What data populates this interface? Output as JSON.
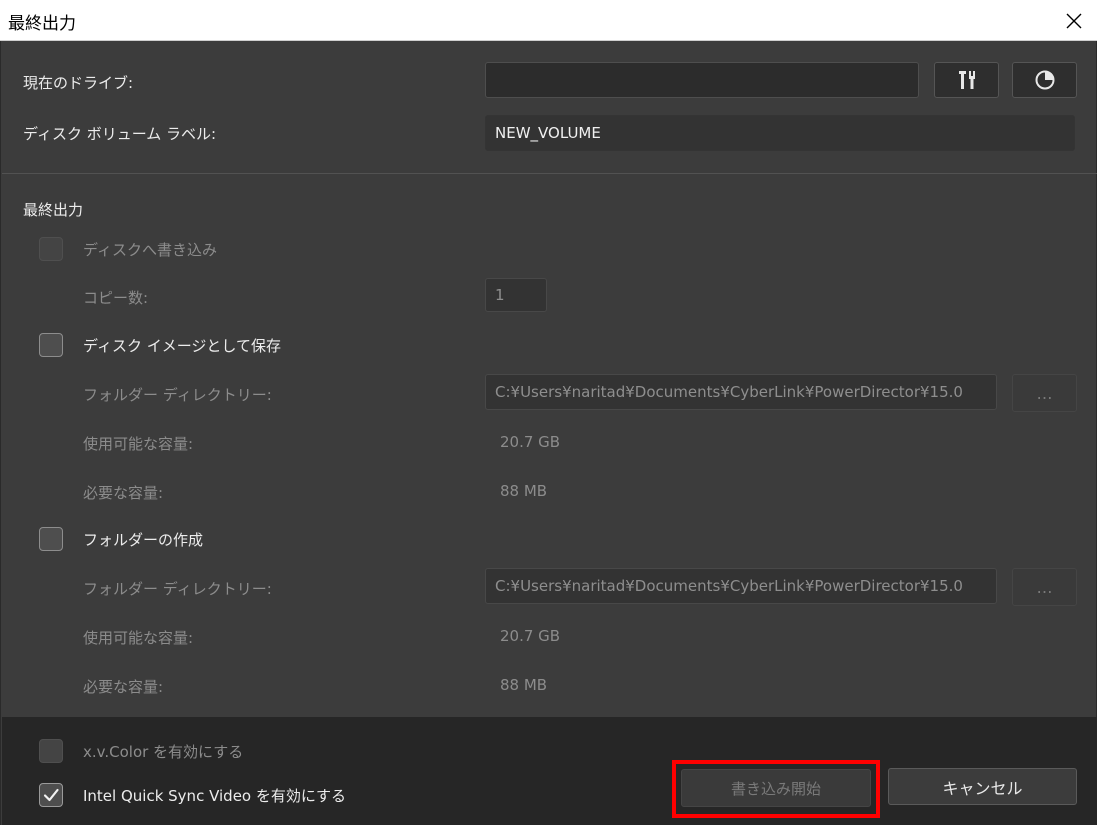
{
  "window": {
    "title": "最終出力"
  },
  "drive": {
    "label": "現在のドライブ:",
    "value": ""
  },
  "volume": {
    "label": "ディスク ボリューム ラベル:",
    "value": "NEW_VOLUME"
  },
  "output": {
    "heading": "最終出力",
    "burn_to_disc": {
      "label": "ディスクへ書き込み",
      "checked": false,
      "enabled": false
    },
    "copies": {
      "label": "コピー数:",
      "value": "1"
    },
    "save_image": {
      "label": "ディスク イメージとして保存",
      "checked": false,
      "folder_label": "フォルダー ディレクトリー:",
      "folder_value": "C:¥Users¥naritad¥Documents¥CyberLink¥PowerDirector¥15.0",
      "browse_label": "…",
      "available_label": "使用可能な容量:",
      "available_value": "20.7 GB",
      "required_label": "必要な容量:",
      "required_value": "88 MB"
    },
    "create_folder": {
      "label": "フォルダーの作成",
      "checked": false,
      "folder_label": "フォルダー ディレクトリー:",
      "folder_value": "C:¥Users¥naritad¥Documents¥CyberLink¥PowerDirector¥15.0",
      "browse_label": "…",
      "available_label": "使用可能な容量:",
      "available_value": "20.7 GB",
      "required_label": "必要な容量:",
      "required_value": "88 MB"
    }
  },
  "footer": {
    "xvcolor": {
      "label": "x.v.Color を有効にする",
      "checked": false,
      "enabled": false
    },
    "quicksync": {
      "label": "Intel Quick Sync Video を有効にする",
      "checked": true
    },
    "start_button": "書き込み開始",
    "cancel_button": "キャンセル"
  },
  "colors": {
    "highlight": "#ff0000",
    "background": "#3c3c3c",
    "footer": "#262626"
  }
}
